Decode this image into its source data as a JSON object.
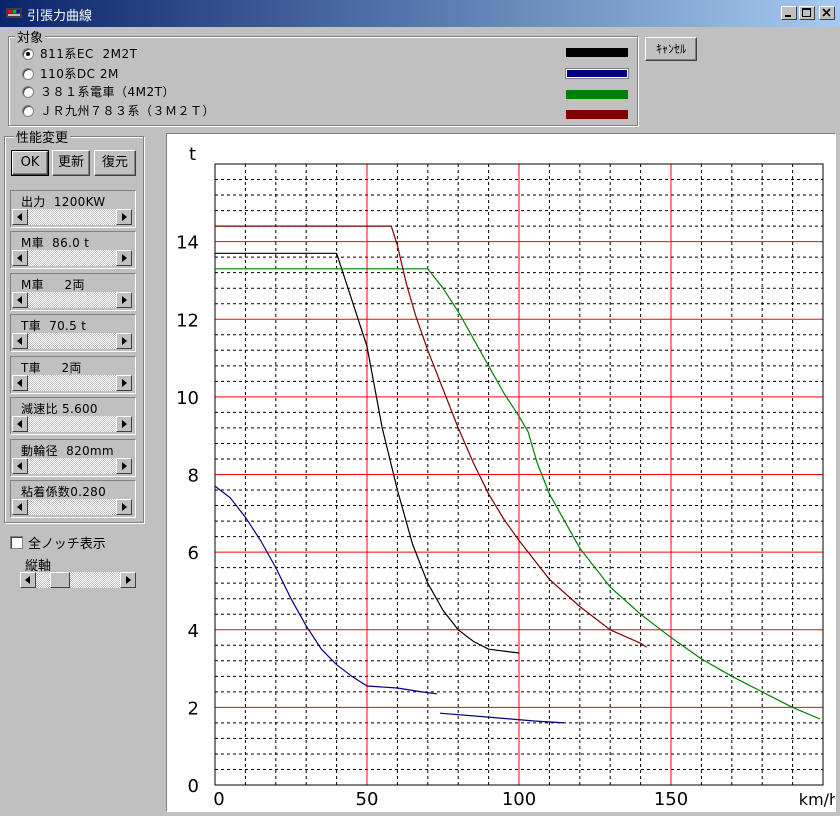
{
  "window": {
    "title": "引張力曲線"
  },
  "targets_group": {
    "legend": "対象",
    "options": [
      {
        "label": "811系EC  2M2T",
        "selected": true,
        "color": "#000000"
      },
      {
        "label": "110系DC 2M",
        "selected": false,
        "color": "#000080"
      },
      {
        "label": "３８１系電車（4M2T）",
        "selected": false,
        "color": "#008000"
      },
      {
        "label": "ＪＲ九州７８３系（３Ｍ２Ｔ）",
        "selected": false,
        "color": "#800000"
      }
    ]
  },
  "cancel_button": "ｷｬﾝｾﾙ",
  "perf_group": {
    "legend": "性能変更",
    "ok_label": "OK",
    "update_label": "更新",
    "restore_label": "復元",
    "params": [
      {
        "label": "出力  1200KW"
      },
      {
        "label": "M車  86.0 t"
      },
      {
        "label": "M車     2両"
      },
      {
        "label": "T車  70.5 t"
      },
      {
        "label": "T車     2両"
      },
      {
        "label": "減速比 5.600"
      },
      {
        "label": "動輪径  820mm"
      },
      {
        "label": "粘着係数0.280"
      }
    ]
  },
  "all_notch": {
    "label": "全ノッチ表示",
    "checked": false
  },
  "vertical_axis": {
    "label": "縦軸"
  },
  "chart_data": {
    "type": "line",
    "ylabel": "t",
    "xlabel": "km/h",
    "xlim": [
      0,
      200
    ],
    "ylim": [
      0,
      16
    ],
    "xticks": [
      0,
      50,
      100,
      150
    ],
    "yticks": [
      0,
      2,
      4,
      6,
      8,
      10,
      12,
      14
    ],
    "series": [
      {
        "color": "#000000",
        "points": [
          [
            0,
            13.7
          ],
          [
            40,
            13.7
          ],
          [
            50,
            11.3
          ],
          [
            55,
            9.2
          ],
          [
            60,
            7.6
          ],
          [
            65,
            6.2
          ],
          [
            70,
            5.2
          ],
          [
            75,
            4.5
          ],
          [
            80,
            4.0
          ],
          [
            85,
            3.7
          ],
          [
            90,
            3.5
          ],
          [
            100,
            3.4
          ]
        ]
      },
      {
        "color": "#000080",
        "points": [
          [
            0,
            7.7
          ],
          [
            5,
            7.4
          ],
          [
            10,
            6.9
          ],
          [
            15,
            6.3
          ],
          [
            20,
            5.6
          ],
          [
            25,
            4.8
          ],
          [
            30,
            4.1
          ],
          [
            35,
            3.5
          ],
          [
            40,
            3.1
          ],
          [
            45,
            2.8
          ],
          [
            50,
            2.55
          ],
          [
            60,
            2.5
          ],
          [
            68,
            2.4
          ],
          [
            73,
            2.35
          ]
        ]
      },
      {
        "color": "#000080",
        "points": [
          [
            74,
            1.85
          ],
          [
            90,
            1.75
          ],
          [
            105,
            1.65
          ],
          [
            115,
            1.6
          ]
        ]
      },
      {
        "color": "#008000",
        "points": [
          [
            0,
            13.3
          ],
          [
            65,
            13.3
          ],
          [
            70,
            13.3
          ],
          [
            75,
            12.8
          ],
          [
            80,
            12.2
          ],
          [
            85,
            11.5
          ],
          [
            90,
            10.8
          ],
          [
            95,
            10.1
          ],
          [
            100,
            9.5
          ],
          [
            103,
            9.1
          ],
          [
            106,
            8.3
          ],
          [
            110,
            7.5
          ],
          [
            120,
            6.1
          ],
          [
            130,
            5.1
          ],
          [
            140,
            4.4
          ],
          [
            150,
            3.8
          ],
          [
            160,
            3.25
          ],
          [
            170,
            2.8
          ],
          [
            180,
            2.4
          ],
          [
            190,
            2.0
          ],
          [
            199,
            1.7
          ]
        ]
      },
      {
        "color": "#800000",
        "points": [
          [
            0,
            14.4
          ],
          [
            58,
            14.4
          ],
          [
            60,
            13.9
          ],
          [
            63,
            12.9
          ],
          [
            66,
            12.1
          ],
          [
            70,
            11.2
          ],
          [
            75,
            10.2
          ],
          [
            80,
            9.2
          ],
          [
            85,
            8.3
          ],
          [
            90,
            7.5
          ],
          [
            95,
            6.85
          ],
          [
            100,
            6.3
          ],
          [
            110,
            5.3
          ],
          [
            120,
            4.6
          ],
          [
            130,
            4.0
          ],
          [
            140,
            3.65
          ],
          [
            142,
            3.55
          ]
        ]
      }
    ]
  }
}
